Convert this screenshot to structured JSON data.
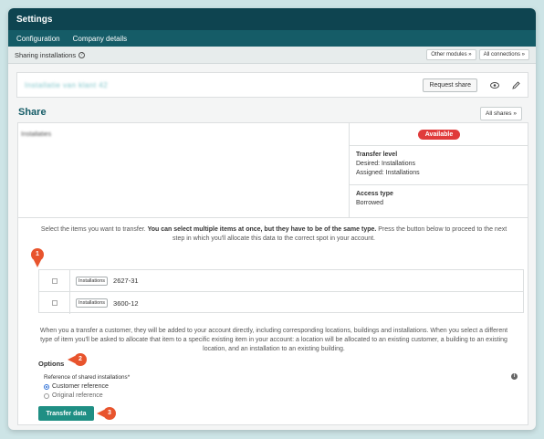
{
  "window": {
    "title": "Settings"
  },
  "nav": {
    "items": [
      "Configuration",
      "Company details"
    ]
  },
  "subheader": {
    "label": "Sharing installations",
    "other_modules": "Other modules »",
    "all_connections": "All connections »"
  },
  "installation": {
    "name_blurred": "Installatie van klant 42",
    "request_share_label": "Request share"
  },
  "share": {
    "title": "Share",
    "all_shares_label": "All shares »",
    "name_blurred": "Installaties",
    "status": "Available",
    "transfer_level_heading": "Transfer level",
    "desired": "Desired: Installations",
    "assigned": "Assigned: Installations",
    "access_type_heading": "Access type",
    "access_type_value": "Borrowed"
  },
  "select_info": {
    "pre": "Select the items you want to transfer. ",
    "bold": "You can select multiple items at once, but they have to be of the same type.",
    "post": " Press the button below to proceed to the next step in which you'll allocate this data to the correct spot in your account."
  },
  "items": [
    {
      "tag": "Installations",
      "value": "2627-31"
    },
    {
      "tag": "Installations",
      "value": "3600-12"
    }
  ],
  "note": "When you a transfer a customer, they will be added to your account directly, including corresponding locations, buildings and installations. When you select a different type of item you'll be asked to allocate that item to a specific existing item in your account: a location will be allocated to an existing customer, a building to an existing location, and an installation to an existing building.",
  "options": {
    "title": "Options",
    "reference_label": "Reference of shared installations*",
    "choices": [
      "Customer reference",
      "Original reference"
    ],
    "selected": "Customer reference"
  },
  "transfer_button": "Transfer data",
  "markers": [
    "1",
    "2",
    "3"
  ],
  "colors": {
    "header": "#0e4450",
    "nav": "#155c67",
    "accent": "#1f8f84",
    "badge": "#e03b3b",
    "marker": "#e8542d"
  }
}
